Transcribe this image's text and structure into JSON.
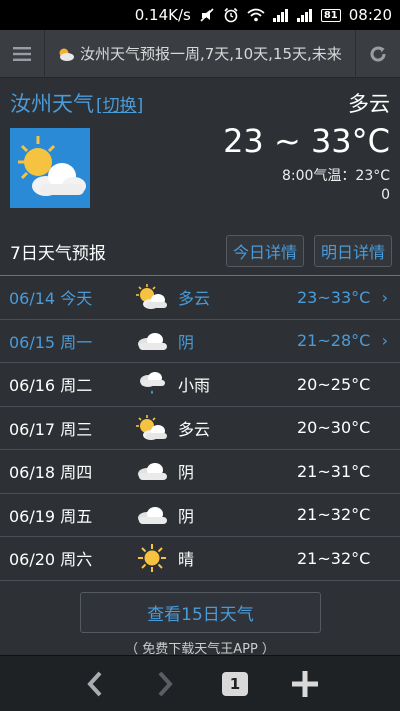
{
  "status_bar": {
    "speed": "0.14K/s",
    "battery": "81",
    "time": "08:20"
  },
  "url_bar": {
    "page_title": "汝州天气预报一周,7天,10天,15天,未来"
  },
  "city": {
    "name": "汝州天气",
    "switch_label": "切换",
    "switch_open": "[",
    "switch_close": "]",
    "condition": "多云"
  },
  "current": {
    "temp_range": "23 ~ 33°C",
    "observed": "8:00气温：23°C",
    "extra": "0"
  },
  "forecast": {
    "title": "7日天气预报",
    "today_detail": "今日详情",
    "tomorrow_detail": "明日详情",
    "days": [
      {
        "date": "06/14 今天",
        "icon": "partly-cloudy-icon",
        "cond": "多云",
        "temp": "23~33°C",
        "arrow": "›"
      },
      {
        "date": "06/15 周一",
        "icon": "cloudy-icon",
        "cond": "阴",
        "temp": "21~28°C",
        "arrow": "›"
      },
      {
        "date": "06/16 周二",
        "icon": "light-rain-icon",
        "cond": "小雨",
        "temp": "20~25°C",
        "arrow": ""
      },
      {
        "date": "06/17 周三",
        "icon": "partly-cloudy-icon",
        "cond": "多云",
        "temp": "20~30°C",
        "arrow": ""
      },
      {
        "date": "06/18 周四",
        "icon": "cloudy-icon",
        "cond": "阴",
        "temp": "21~31°C",
        "arrow": ""
      },
      {
        "date": "06/19 周五",
        "icon": "cloudy-icon",
        "cond": "阴",
        "temp": "21~32°C",
        "arrow": ""
      },
      {
        "date": "06/20 周六",
        "icon": "sunny-icon",
        "cond": "晴",
        "temp": "21~32°C",
        "arrow": ""
      }
    ]
  },
  "fifteen_day_button": "查看15日天气",
  "app_promo": "（ 免费下载天气王APP ）",
  "bottom_bar": {
    "tab_count": "1"
  },
  "colors": {
    "accent": "#4a9bd9",
    "background": "#2d3135"
  }
}
